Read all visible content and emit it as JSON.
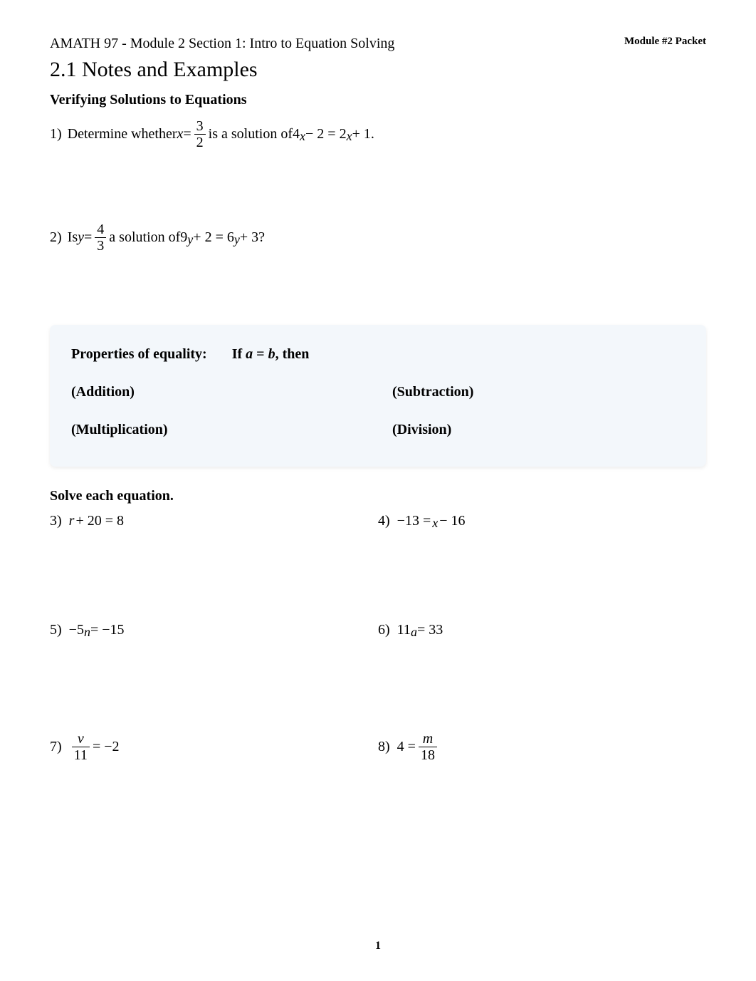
{
  "header": {
    "course_title": "AMATH 97 - Module 2 Section 1: Intro to Equation Solving",
    "module_packet": "Module #2 Packet"
  },
  "section_title": "2.1 Notes and Examples",
  "subsection_title": "Verifying Solutions to Equations",
  "problem1": {
    "num": "1)",
    "text_before": "Determine whether ",
    "var": "x",
    "equals": " = ",
    "frac_num": "3",
    "frac_den": "2",
    "text_mid": " is a solution of ",
    "eq_4": "4",
    "eq_x1": "x",
    "eq_minus2": " − 2 = 2",
    "eq_x2": "x",
    "eq_plus1": " + 1",
    "period": "."
  },
  "problem2": {
    "num": "2)",
    "text_before": "Is ",
    "var": "y",
    "equals": " = ",
    "frac_num": "4",
    "frac_den": "3",
    "text_mid": " a solution of ",
    "eq_9": "9",
    "eq_y1": "y",
    "eq_plus2": " + 2 = 6",
    "eq_y2": "y",
    "eq_plus3": " + 3 ",
    "question": "?"
  },
  "properties": {
    "title": "Properties of equality:",
    "if_text_pre": "If ",
    "if_a": "a",
    "if_eq": " = ",
    "if_b": "b",
    "if_then": ", then",
    "addition": "(Addition)",
    "subtraction": "(Subtraction)",
    "multiplication": "(Multiplication)",
    "division": "(Division)"
  },
  "solve_title": "Solve each equation.",
  "problems": {
    "p3": {
      "num": "3)",
      "var": "r",
      "rest": " + 20 = 8"
    },
    "p4": {
      "num": "4)",
      "pre": "−13 = ",
      "var": "x",
      "rest": " − 16"
    },
    "p5": {
      "num": "5)",
      "pre": "−5",
      "var": "n",
      "rest": " = −15"
    },
    "p6": {
      "num": "6)",
      "pre": "11",
      "var": "a",
      "rest": " = 33"
    },
    "p7": {
      "num": "7)",
      "frac_num": "v",
      "frac_den": "11",
      "rest": " = −2"
    },
    "p8": {
      "num": "8)",
      "pre": "4 = ",
      "frac_num": "m",
      "frac_den": "18"
    }
  },
  "page_number": "1"
}
